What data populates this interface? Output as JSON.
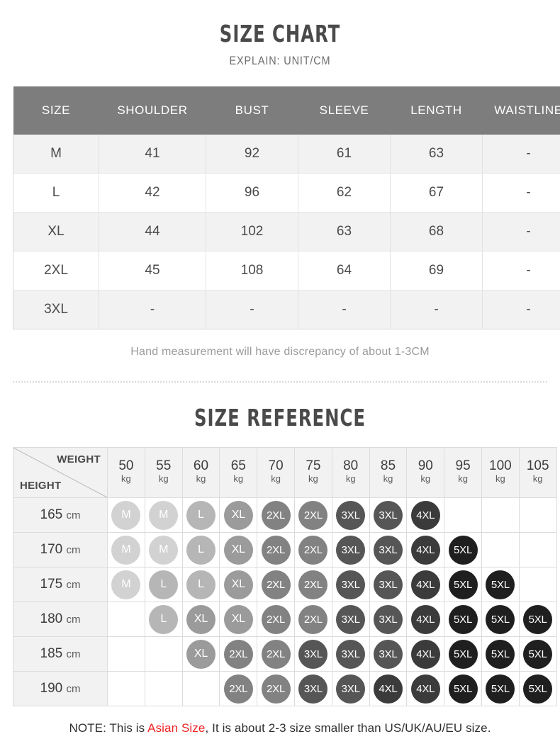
{
  "size_chart": {
    "title": "SIZE CHART",
    "subtitle": "EXPLAIN: UNIT/CM",
    "columns": [
      "SIZE",
      "SHOULDER",
      "BUST",
      "SLEEVE",
      "LENGTH",
      "WAISTLINE"
    ],
    "rows": [
      {
        "size": "M",
        "shoulder": "41",
        "bust": "92",
        "sleeve": "61",
        "length": "63",
        "waistline": "-"
      },
      {
        "size": "L",
        "shoulder": "42",
        "bust": "96",
        "sleeve": "62",
        "length": "67",
        "waistline": "-"
      },
      {
        "size": "XL",
        "shoulder": "44",
        "bust": "102",
        "sleeve": "63",
        "length": "68",
        "waistline": "-"
      },
      {
        "size": "2XL",
        "shoulder": "45",
        "bust": "108",
        "sleeve": "64",
        "length": "69",
        "waistline": "-"
      },
      {
        "size": "3XL",
        "shoulder": "-",
        "bust": "-",
        "sleeve": "-",
        "length": "-",
        "waistline": "-"
      }
    ],
    "footnote": "Hand measurement will have discrepancy of about 1-3CM"
  },
  "size_reference": {
    "title": "SIZE REFERENCE",
    "corner": {
      "weight_label": "WEIGHT",
      "height_label": "HEIGHT"
    },
    "weight_unit": "kg",
    "height_unit": "cm",
    "weights": [
      "50",
      "55",
      "60",
      "65",
      "70",
      "75",
      "80",
      "85",
      "90",
      "95",
      "100",
      "105"
    ],
    "heights": [
      "165",
      "170",
      "175",
      "180",
      "185",
      "190"
    ],
    "grid": [
      [
        "M",
        "M",
        "L",
        "XL",
        "2XL",
        "2XL",
        "3XL",
        "3XL",
        "4XL",
        "",
        "",
        ""
      ],
      [
        "M",
        "M",
        "L",
        "XL",
        "2XL",
        "2XL",
        "3XL",
        "3XL",
        "4XL",
        "5XL",
        "",
        ""
      ],
      [
        "M",
        "L",
        "L",
        "XL",
        "2XL",
        "2XL",
        "3XL",
        "3XL",
        "4XL",
        "5XL",
        "5XL",
        ""
      ],
      [
        "",
        "L",
        "XL",
        "XL",
        "2XL",
        "2XL",
        "3XL",
        "3XL",
        "4XL",
        "5XL",
        "5XL",
        "5XL"
      ],
      [
        "",
        "",
        "XL",
        "2XL",
        "2XL",
        "3XL",
        "3XL",
        "3XL",
        "4XL",
        "5XL",
        "5XL",
        "5XL"
      ],
      [
        "",
        "",
        "",
        "2XL",
        "2XL",
        "3XL",
        "3XL",
        "4XL",
        "4XL",
        "5XL",
        "5XL",
        "5XL"
      ]
    ]
  },
  "bottom_note": {
    "prefix": "NOTE: This is ",
    "accent": "Asian Size",
    "suffix": ", It is about 2-3 size smaller than US/UK/AU/EU size."
  },
  "colors": {
    "header_gray": "#7d7d7d",
    "row_alt": "#f2f2f2",
    "accent_red": "#ee2222",
    "bubble_M": "#d2d2d2",
    "bubble_L": "#b6b6b6",
    "bubble_XL": "#9b9b9b",
    "bubble_2XL": "#828282",
    "bubble_3XL": "#565656",
    "bubble_4XL": "#3b3b3b",
    "bubble_5XL": "#1f1f1f"
  }
}
